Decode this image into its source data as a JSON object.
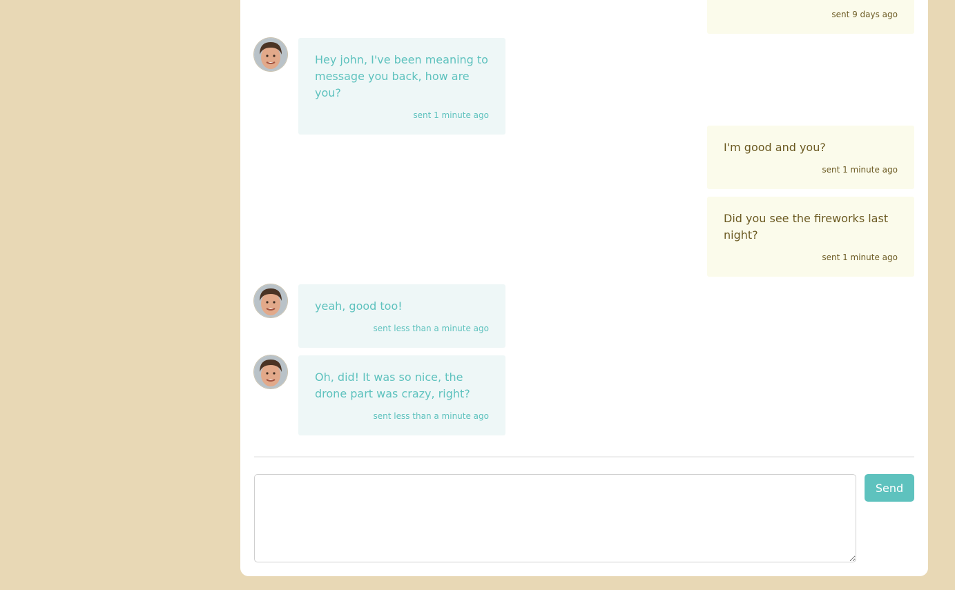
{
  "messages": [
    {
      "direction": "out",
      "text": "",
      "time": "sent 9 days ago"
    },
    {
      "direction": "in",
      "text": "Hey john, I've been meaning to message you back, how are you?",
      "time": "sent 1 minute ago"
    },
    {
      "direction": "out",
      "text": "I'm good and you?",
      "time": "sent 1 minute ago"
    },
    {
      "direction": "out",
      "text": "Did you see the fireworks last night?",
      "time": "sent 1 minute ago"
    },
    {
      "direction": "in",
      "text": "yeah, good too!",
      "time": "sent less than a minute ago"
    },
    {
      "direction": "in",
      "text": "Oh, did! It was so nice, the drone part was crazy, right?",
      "time": "sent less than a minute ago"
    }
  ],
  "composer": {
    "value": "",
    "placeholder": ""
  },
  "send_label": "Send",
  "colors": {
    "background": "#e8d8b5",
    "incoming_bubble": "#eef7f7",
    "incoming_text": "#5ec2be",
    "outgoing_bubble": "#fbfbeb",
    "outgoing_text": "#6b5a22",
    "accent": "#5ec2be"
  }
}
